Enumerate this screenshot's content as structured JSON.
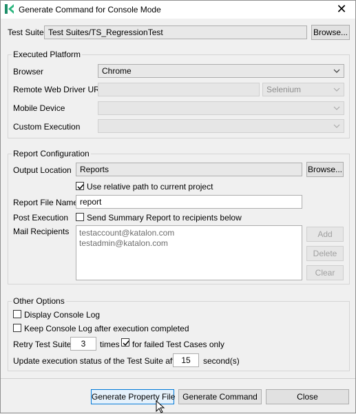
{
  "window": {
    "title": "Generate Command for Console Mode",
    "icon": "katalon-logo-icon",
    "accent_color": "#2ab57d"
  },
  "test_suite": {
    "label": "Test Suite",
    "value": "Test Suites/TS_RegressionTest",
    "browse_label": "Browse..."
  },
  "executed_platform": {
    "title": "Executed Platform",
    "browser_label": "Browser",
    "browser_value": "Chrome",
    "remote_label": "Remote Web Driver URL",
    "remote_value": "",
    "remote_type": "Selenium",
    "mobile_label": "Mobile Device",
    "mobile_value": "",
    "custom_label": "Custom Execution",
    "custom_value": ""
  },
  "report": {
    "title": "Report Configuration",
    "output_label": "Output Location",
    "output_value": "Reports",
    "browse_label": "Browse...",
    "relative_label": "Use relative path to current project",
    "relative_checked": true,
    "file_name_label": "Report File Name",
    "file_name_value": "report",
    "post_label": "Post Execution",
    "summary_label": "Send Summary Report to recipients below",
    "summary_checked": false,
    "mail_label": "Mail Recipients",
    "recipients": [
      "testaccount@katalon.com",
      "testadmin@katalon.com"
    ],
    "add_label": "Add",
    "delete_label": "Delete",
    "clear_label": "Clear"
  },
  "other": {
    "title": "Other Options",
    "console_log_label": "Display Console Log",
    "console_log_checked": false,
    "keep_log_label": "Keep Console Log after execution completed",
    "keep_log_checked": false,
    "retry_label": "Retry Test Suite",
    "retry_value": "3",
    "times_label": "times",
    "failed_only_label": "for failed Test Cases only",
    "failed_only_checked": true,
    "update_label": "Update execution status of the Test Suite after",
    "update_value": "15",
    "seconds_label": "second(s)"
  },
  "footer": {
    "generate_property_label": "Generate Property File",
    "generate_command_label": "Generate Command",
    "close_label": "Close"
  }
}
